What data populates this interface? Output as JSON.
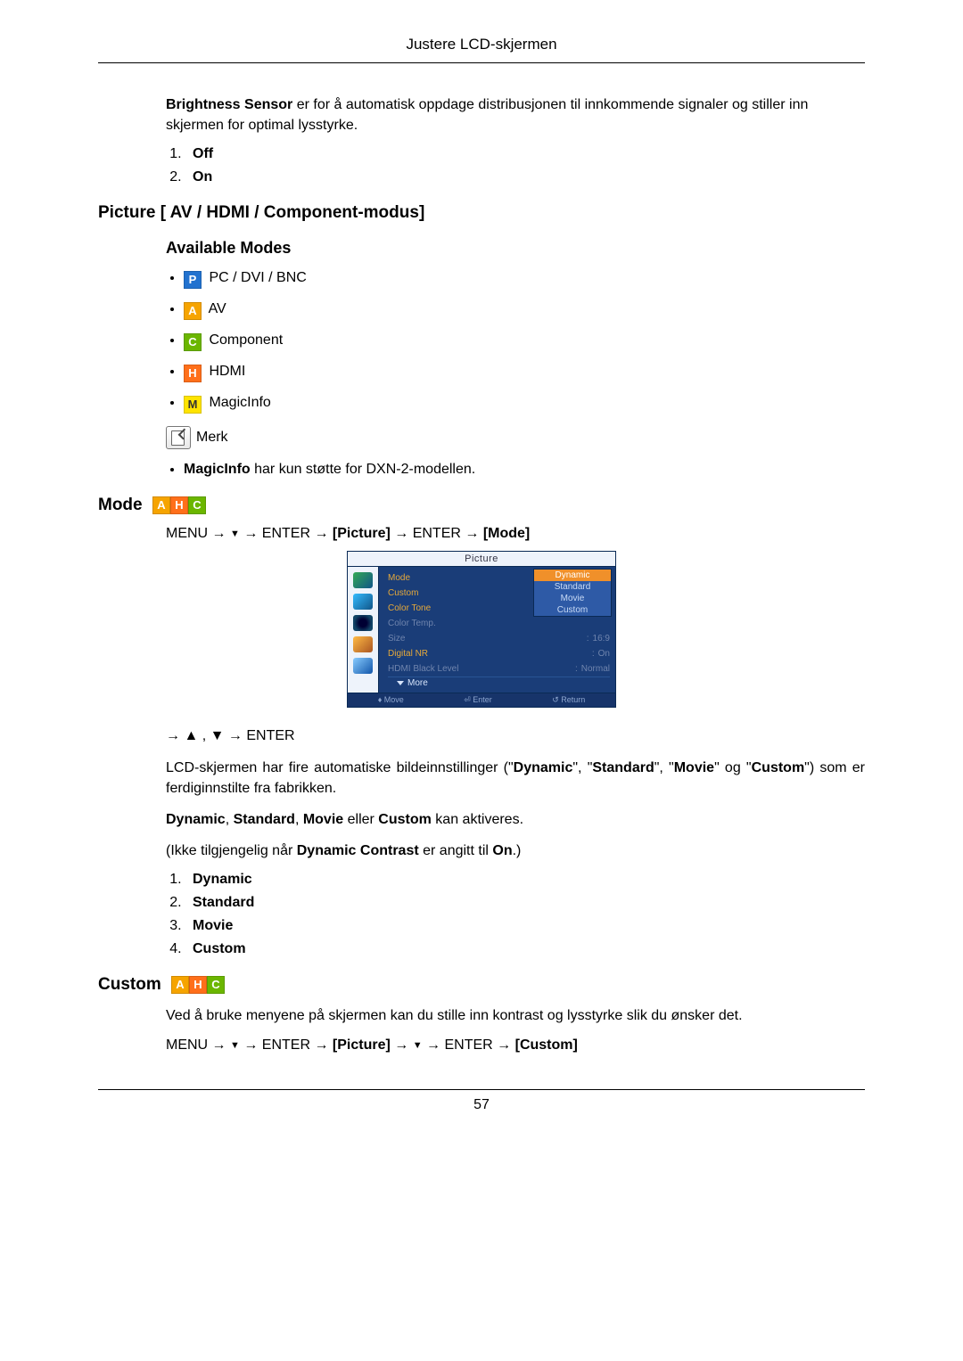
{
  "header": {
    "title": "Justere LCD-skjermen"
  },
  "brightness": {
    "intro_bold": "Brightness Sensor",
    "intro_rest": " er for å automatisk oppdage distribusjonen til innkommende signaler og stiller inn skjermen for optimal lysstyrke.",
    "items": [
      "Off",
      "On"
    ]
  },
  "picture_heading": "Picture [ AV / HDMI / Component-modus]",
  "available_modes_title": "Available Modes",
  "modes": [
    {
      "letter": "P",
      "cls": "ic-P",
      "label": " PC / DVI / BNC"
    },
    {
      "letter": "A",
      "cls": "ic-A",
      "label": " AV"
    },
    {
      "letter": "C",
      "cls": "ic-C",
      "label": " Component"
    },
    {
      "letter": "H",
      "cls": "ic-H",
      "label": " HDMI"
    },
    {
      "letter": "M",
      "cls": "ic-M",
      "label": " MagicInfo"
    }
  ],
  "note": {
    "label": " Merk",
    "text_bold": "MagicInfo",
    "text_rest": " har kun støtte for DXN-2-modellen."
  },
  "mode_heading": "Mode ",
  "mode_badges": [
    {
      "letter": "A",
      "cls": "ic-A"
    },
    {
      "letter": "H",
      "cls": "ic-H"
    },
    {
      "letter": "C",
      "cls": "ic-C"
    }
  ],
  "mode_path": {
    "pre": "MENU → ",
    "enter1": " → ENTER → ",
    "picture": "[Picture]",
    "enter2": " → ENTER → ",
    "mode": "[Mode]"
  },
  "osd": {
    "title": "Picture",
    "rows": [
      {
        "lab": "Mode",
        "val": "Dynamic",
        "labcls": "lab"
      },
      {
        "lab": "Custom",
        "val": "",
        "labcls": "lab"
      },
      {
        "lab": "Color Tone",
        "val": "",
        "labcls": "lab"
      },
      {
        "lab": "Color Temp.",
        "val": "",
        "labcls": "lab dim"
      },
      {
        "lab": "Size",
        "val": "16:9",
        "labcls": "lab dim"
      },
      {
        "lab": "Digital NR",
        "val": "On",
        "labcls": "lab"
      },
      {
        "lab": "HDMI Black Level",
        "val": "Normal",
        "labcls": "lab dim"
      }
    ],
    "popup": [
      "Dynamic",
      "Standard",
      "Movie",
      "Custom"
    ],
    "more": "More",
    "foot": {
      "move": "Move",
      "enter": "Enter",
      "ret": "Return"
    }
  },
  "mode_post_nav": "→ ▲ , ▼ → ENTER",
  "mode_para": {
    "start": "LCD-skjermen har fire automatiske bildeinnstillinger (\"",
    "d": "Dynamic",
    "s1": "\", \"",
    "s": "Standard",
    "s2": "\", \"",
    "m": "Movie",
    "s3": "\" og \"",
    "c": "Custom",
    "end": "\") som er ferdiginnstilte fra fabrikken."
  },
  "mode_line2": {
    "a": "Dynamic",
    "b": ", ",
    "c": "Standard",
    "d": ", ",
    "e": "Movie",
    "f": " eller ",
    "g": "Custom",
    "h": " kan aktiveres."
  },
  "mode_line3": {
    "a": "(Ikke tilgjengelig når ",
    "b": "Dynamic Contrast",
    "c": " er angitt til ",
    "d": "On",
    "e": ".)"
  },
  "mode_options": [
    "Dynamic",
    "Standard",
    "Movie",
    "Custom"
  ],
  "custom_heading": "Custom ",
  "custom_text": "Ved å bruke menyene på skjermen kan du stille inn kontrast og lysstyrke slik du ønsker det.",
  "custom_path": {
    "pre": "MENU → ",
    "enter1": " → ENTER → ",
    "picture": "[Picture]",
    "mid": " → ",
    "enter2": " → ENTER → ",
    "custom": "[Custom]"
  },
  "page_number": "57"
}
